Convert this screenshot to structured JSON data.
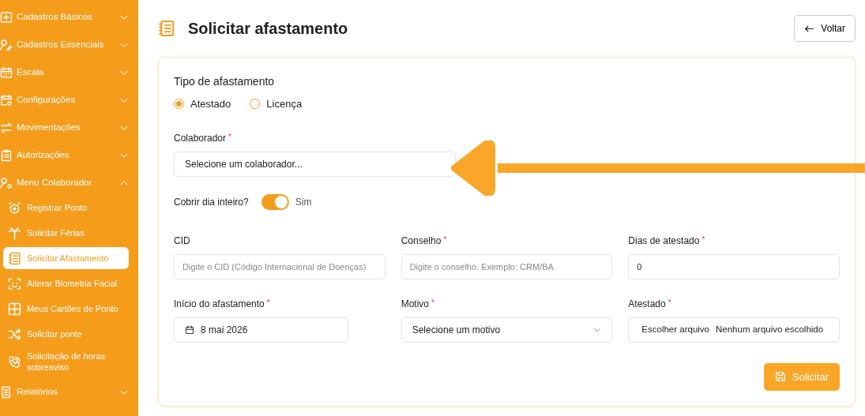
{
  "sidebar": {
    "items": [
      {
        "label": "Cadastros Básicos",
        "expanded": false
      },
      {
        "label": "Cadastros Essenciais",
        "expanded": false
      },
      {
        "label": "Escala",
        "expanded": false
      },
      {
        "label": "Configurações",
        "expanded": false
      },
      {
        "label": "Movimentações",
        "expanded": false
      },
      {
        "label": "Autorizações",
        "expanded": false
      },
      {
        "label": "Menu Colaborador",
        "expanded": true,
        "children": [
          {
            "label": "Registrar Ponto",
            "selected": false
          },
          {
            "label": "Solicitar Férias",
            "selected": false
          },
          {
            "label": "Solicitar Afastamento",
            "selected": true
          },
          {
            "label": "Alterar Biometria Facial",
            "selected": false
          },
          {
            "label": "Meus Cartões de Ponto",
            "selected": false
          },
          {
            "label": "Solicitar ponte",
            "selected": false
          },
          {
            "label": "Solicitação de horas sobreaviso",
            "selected": false
          }
        ]
      },
      {
        "label": "Relatórios",
        "expanded": false
      }
    ]
  },
  "page": {
    "title": "Solicitar afastamento",
    "back_button": "Voltar"
  },
  "form": {
    "type_label": "Tipo de afastamento",
    "type_options": [
      {
        "label": "Atestado",
        "selected": true
      },
      {
        "label": "Licença",
        "selected": false
      }
    ],
    "collaborator": {
      "label": "Colaborador",
      "required_mark": "*",
      "value": "Selecione um colaborador..."
    },
    "full_day": {
      "label": "Cobrir dia inteiro?",
      "on": true,
      "text": "Sim"
    },
    "rows": [
      [
        {
          "kind": "text",
          "label": "CID",
          "placeholder": "Digite o CID (Código Internacional de Doenças)"
        },
        {
          "kind": "text",
          "label": "Conselho",
          "required_mark": "*",
          "placeholder": "Digite o conselho. Exemplo: CRM/BA"
        },
        {
          "kind": "text",
          "label": "Dias de atestado",
          "required_mark": "*",
          "value": "0"
        }
      ],
      [
        {
          "kind": "date",
          "label": "Início do afastamento",
          "required_mark": "*",
          "value": "8 mai 2026"
        },
        {
          "kind": "select",
          "label": "Motivo",
          "required_mark": "*",
          "value": "Selecione um motivo"
        },
        {
          "kind": "file",
          "label": "Atestado",
          "required_mark": "*",
          "button": "Escolher arquivo",
          "value": "Nenhum arquivo escolhido"
        }
      ]
    ],
    "submit": "Solicitar"
  }
}
